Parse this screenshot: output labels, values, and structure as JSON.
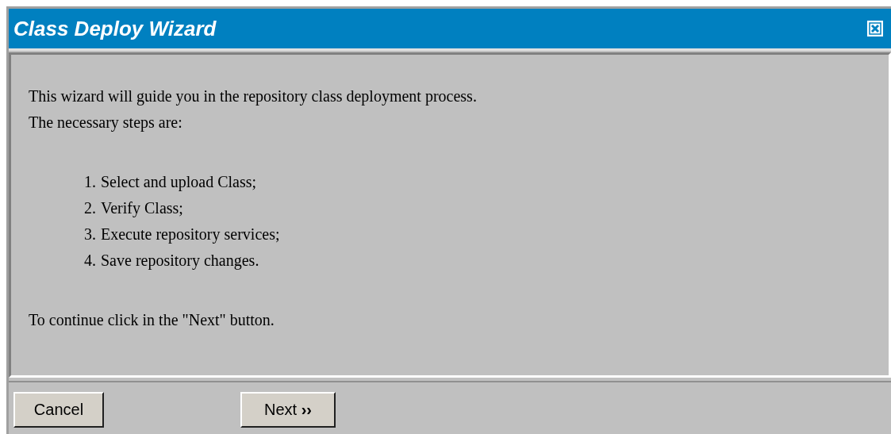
{
  "window": {
    "title": "Class Deploy Wizard"
  },
  "intro": [
    "This wizard will guide you in the repository class deployment process.",
    "The necessary steps are:"
  ],
  "steps": [
    {
      "number": "1.",
      "text": "Select and upload Class;"
    },
    {
      "number": "2.",
      "text": "Verify Class;"
    },
    {
      "number": "3.",
      "text": "Execute repository services;"
    },
    {
      "number": "4.",
      "text": "Save repository changes."
    }
  ],
  "footer_text": "To continue click in the \"Next\" button.",
  "buttons": {
    "cancel": "Cancel",
    "next": "Next",
    "next_arrows": "››"
  }
}
